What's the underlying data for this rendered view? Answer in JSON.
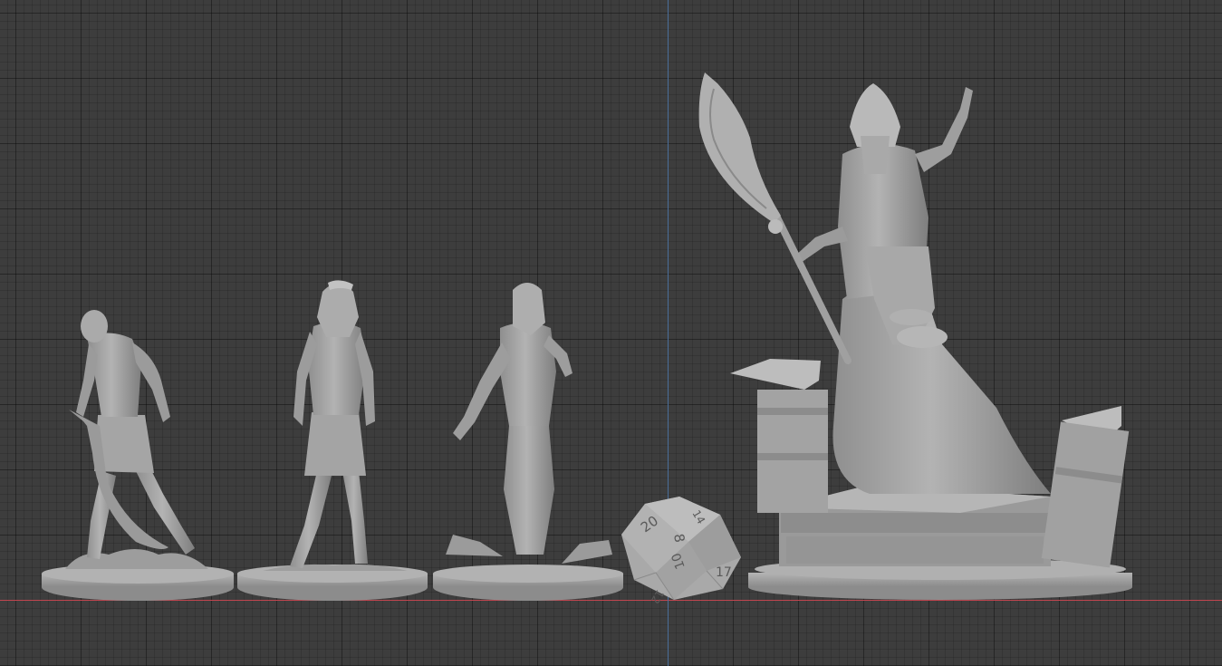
{
  "viewport": {
    "editor": "3D Viewport",
    "colors": {
      "background": "#3d3d3d",
      "grid_minor": "#383838",
      "grid_major": "#313131",
      "x_axis": "#c0454f",
      "y_axis": "#4a6e9a",
      "model": "#a7a7a7",
      "model_shadow": "#6f6f6f",
      "model_highlight": "#c8c8c8"
    }
  },
  "objects": [
    {
      "name": "Mummy Warrior with Khopesh",
      "icon": "mummy-figure"
    },
    {
      "name": "Mummy with Headscarf",
      "icon": "mummy-figure"
    },
    {
      "name": "Robed Mummy",
      "icon": "mummy-figure"
    },
    {
      "name": "D20 Die",
      "icon": "d20-die"
    },
    {
      "name": "Mummy Priest on Altar",
      "icon": "priest-figure"
    }
  ],
  "die_faces": [
    "20",
    "8",
    "14",
    "17",
    "12",
    "10"
  ]
}
